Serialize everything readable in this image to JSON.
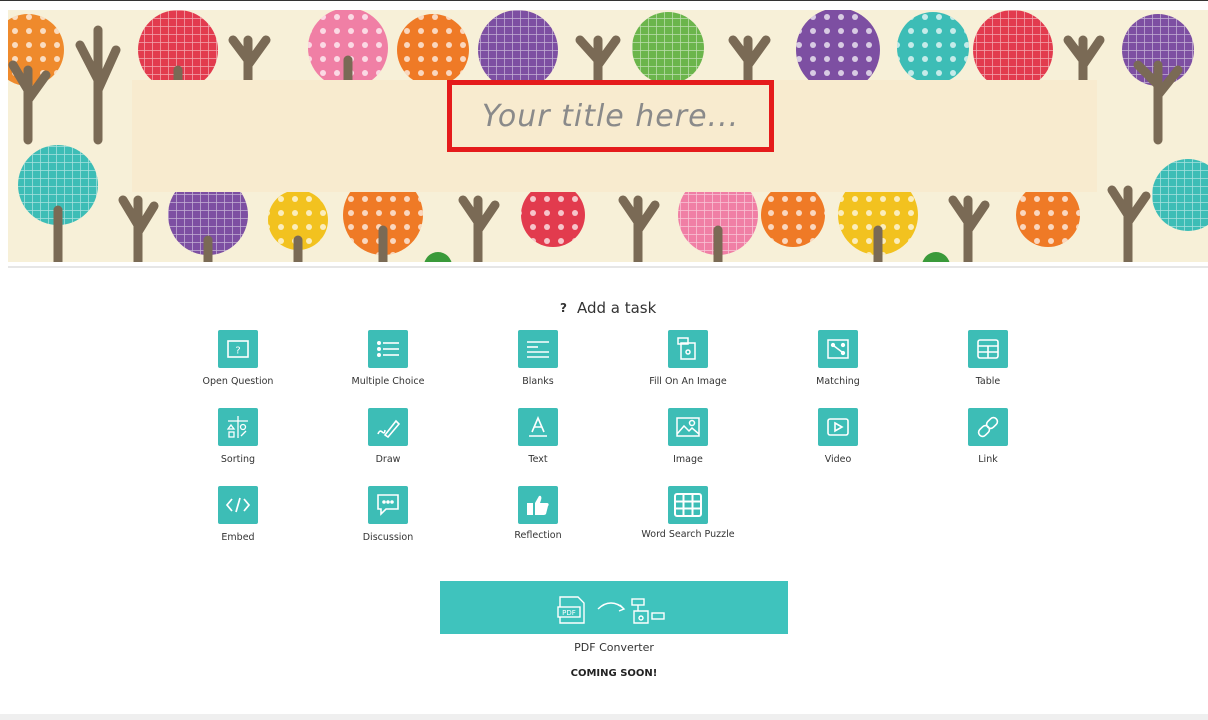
{
  "banner": {
    "title_placeholder": "Your title here..."
  },
  "add_task": {
    "help_symbol": "?",
    "heading": "Add a task",
    "tiles": [
      {
        "label": "Open Question",
        "icon": "question-box-icon"
      },
      {
        "label": "Multiple Choice",
        "icon": "list-icon"
      },
      {
        "label": "Blanks",
        "icon": "blanks-lines-icon"
      },
      {
        "label": "Fill On An Image",
        "icon": "image-fill-icon"
      },
      {
        "label": "Matching",
        "icon": "matching-icon"
      },
      {
        "label": "Table",
        "icon": "table-icon"
      },
      {
        "label": "Sorting",
        "icon": "sorting-icon"
      },
      {
        "label": "Draw",
        "icon": "pencil-icon"
      },
      {
        "label": "Text",
        "icon": "text-a-icon"
      },
      {
        "label": "Image",
        "icon": "image-icon"
      },
      {
        "label": "Video",
        "icon": "play-icon"
      },
      {
        "label": "Link",
        "icon": "link-icon"
      },
      {
        "label": "Embed",
        "icon": "code-icon"
      },
      {
        "label": "Discussion",
        "icon": "chat-bubble-icon"
      },
      {
        "label": "Reflection",
        "icon": "thumbs-up-icon"
      },
      {
        "label": "Word Search Puzzle",
        "icon": "grid-icon"
      }
    ]
  },
  "pdf_converter": {
    "label": "PDF Converter",
    "pdf_badge": "PDF",
    "status": "COMING SOON!"
  },
  "colors": {
    "accent": "#3dbdb6",
    "title_frame": "#e51b1b",
    "banner_bg": "#f7f0d8"
  }
}
